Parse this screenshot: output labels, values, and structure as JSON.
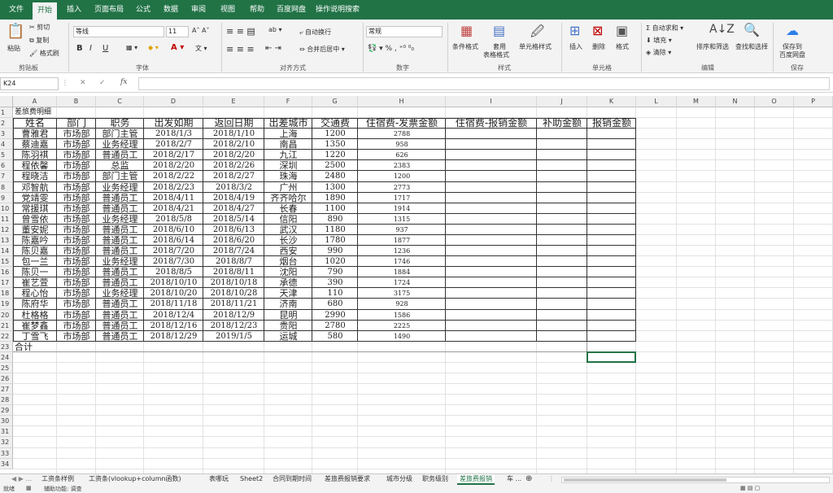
{
  "ribbon_tabs": [
    "文件",
    "开始",
    "插入",
    "页面布局",
    "公式",
    "数据",
    "审阅",
    "视图",
    "帮助",
    "百度网盘",
    "操作说明搜索"
  ],
  "active_tab": "开始",
  "ribbon": {
    "paste": "粘贴",
    "cut": "剪切",
    "copy": "复制",
    "format_painter": "格式刷",
    "clipboard": "剪贴板",
    "font_name": "等线",
    "font_size": "11",
    "bold": "B",
    "italic": "I",
    "underline": "U",
    "font_group": "字体",
    "wrap": "自动换行",
    "merge": "合并后居中",
    "align_group": "对齐方式",
    "number_format": "常规",
    "number_group": "数字",
    "cond_format": "条件格式",
    "table_format_1": "套用",
    "table_format_2": "表格格式",
    "cell_style": "单元格样式",
    "style_group": "样式",
    "insert": "插入",
    "delete": "删除",
    "format": "格式",
    "cells_group": "单元格",
    "autosum": "自动求和",
    "fill": "填充",
    "clear": "清除",
    "sort": "排序和筛选",
    "find": "查找和选择",
    "edit_group": "编辑",
    "save_baidu_1": "保存到",
    "save_baidu_2": "百度网盘",
    "save_group": "保存"
  },
  "namebox": "K24",
  "columns": [
    "A",
    "B",
    "C",
    "D",
    "E",
    "F",
    "G",
    "H",
    "I",
    "J",
    "K",
    "L",
    "M",
    "N",
    "O",
    "P"
  ],
  "table": {
    "title": "差旅费明细",
    "headers": [
      "姓名",
      "部门",
      "职务",
      "出发如期",
      "返回日期",
      "出差城市",
      "交通费",
      "住宿费-发票金额",
      "住宿费-报销金额",
      "补助金额",
      "报销金额"
    ],
    "rows": [
      [
        "曹雅君",
        "市场部",
        "部门主管",
        "2018/1/3",
        "2018/1/10",
        "上海",
        "1200",
        "2788"
      ],
      [
        "蔡迪嘉",
        "市场部",
        "业务经理",
        "2018/2/7",
        "2018/2/10",
        "南昌",
        "1350",
        "958"
      ],
      [
        "陈羽祺",
        "市场部",
        "普通员工",
        "2018/2/17",
        "2018/2/20",
        "九江",
        "1220",
        "626"
      ],
      [
        "程依馨",
        "市场部",
        "总监",
        "2018/2/20",
        "2018/2/26",
        "深圳",
        "2500",
        "2383"
      ],
      [
        "程晓洁",
        "市场部",
        "部门主管",
        "2018/2/22",
        "2018/2/27",
        "珠海",
        "2480",
        "1200"
      ],
      [
        "邓智航",
        "市场部",
        "业务经理",
        "2018/2/23",
        "2018/3/2",
        "广州",
        "1300",
        "2773"
      ],
      [
        "党靖雯",
        "市场部",
        "普通员工",
        "2018/4/11",
        "2018/4/19",
        "齐齐哈尔",
        "1890",
        "1717"
      ],
      [
        "常援琪",
        "市场部",
        "普通员工",
        "2018/4/21",
        "2018/4/27",
        "长春",
        "1100",
        "1914"
      ],
      [
        "曾雪依",
        "市场部",
        "业务经理",
        "2018/5/8",
        "2018/5/14",
        "信阳",
        "890",
        "1315"
      ],
      [
        "董安妮",
        "市场部",
        "普通员工",
        "2018/6/10",
        "2018/6/13",
        "武汉",
        "1180",
        "937"
      ],
      [
        "陈嘉吟",
        "市场部",
        "普通员工",
        "2018/6/14",
        "2018/6/20",
        "长沙",
        "1780",
        "1877"
      ],
      [
        "陈贝嘉",
        "市场部",
        "普通员工",
        "2018/7/20",
        "2018/7/24",
        "西安",
        "990",
        "1236"
      ],
      [
        "包一兰",
        "市场部",
        "业务经理",
        "2018/7/30",
        "2018/8/7",
        "烟台",
        "1020",
        "1746"
      ],
      [
        "陈贝一",
        "市场部",
        "普通员工",
        "2018/8/5",
        "2018/8/11",
        "沈阳",
        "790",
        "1884"
      ],
      [
        "崔艺萱",
        "市场部",
        "普通员工",
        "2018/10/10",
        "2018/10/18",
        "承德",
        "390",
        "1724"
      ],
      [
        "程心怡",
        "市场部",
        "业务经理",
        "2018/10/20",
        "2018/10/28",
        "天津",
        "110",
        "3175"
      ],
      [
        "陈府华",
        "市场部",
        "普通员工",
        "2018/11/18",
        "2018/11/21",
        "济南",
        "680",
        "928"
      ],
      [
        "杜格格",
        "市场部",
        "普通员工",
        "2018/12/4",
        "2018/12/9",
        "昆明",
        "2990",
        "1586"
      ],
      [
        "崔梦鑫",
        "市场部",
        "普通员工",
        "2018/12/16",
        "2018/12/23",
        "贵阳",
        "2780",
        "2225"
      ],
      [
        "丁雪飞",
        "市场部",
        "普通员工",
        "2018/12/29",
        "2019/1/5",
        "运城",
        "580",
        "1490"
      ]
    ],
    "total_label": "合计"
  },
  "sheet_tabs": [
    "工资条样例",
    "工资条(vlookup+column函数)",
    "表哪玩",
    "Sheet2",
    "合同到期时间",
    "差旅费报销要求",
    "城市分级",
    "职务级别",
    "差旅费报销",
    "车 ..."
  ],
  "active_sheet": "差旅费报销",
  "status": {
    "ready": "就绪",
    "accessibility": "辅助功能: 调查"
  }
}
